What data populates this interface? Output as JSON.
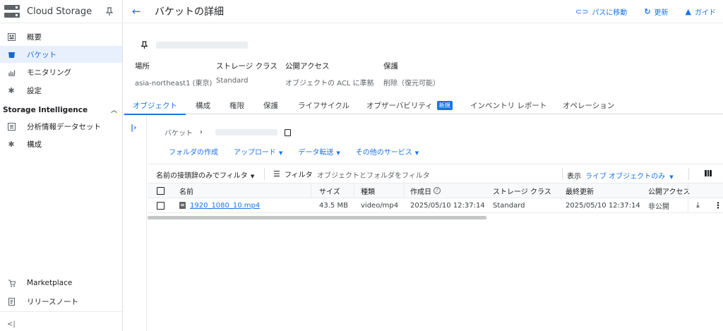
{
  "sidebar": {
    "product_title": "Cloud Storage",
    "items": [
      {
        "label": "概要",
        "icon": "dashboard-icon"
      },
      {
        "label": "バケット",
        "icon": "bucket-icon",
        "active": true
      },
      {
        "label": "モニタリング",
        "icon": "monitoring-icon"
      },
      {
        "label": "設定",
        "icon": "gear-icon"
      }
    ],
    "section_title": "Storage Intelligence",
    "section_items": [
      {
        "label": "分析情報データセット",
        "icon": "dataset-icon"
      },
      {
        "label": "構成",
        "icon": "gear-icon"
      }
    ],
    "bottom_items": [
      {
        "label": "Marketplace",
        "icon": "marketplace-icon"
      },
      {
        "label": "リリースノート",
        "icon": "release-notes-icon"
      }
    ],
    "collapse_glyph": "<|"
  },
  "header": {
    "title": "バケットの詳細",
    "actions": [
      {
        "label": "パスに移動",
        "icon": "link-icon"
      },
      {
        "label": "更新",
        "icon": "refresh-icon"
      },
      {
        "label": "ガイド",
        "icon": "school-icon"
      }
    ]
  },
  "bucket": {
    "meta": [
      {
        "key": "場所",
        "value": "asia-northeast1 (東京)"
      },
      {
        "key": "ストレージ クラス",
        "value": "Standard"
      },
      {
        "key": "公開アクセス",
        "value": "オブジェクトの ACL に準拠"
      },
      {
        "key": "保護",
        "value": "削除（復元可能）"
      }
    ]
  },
  "tabs": [
    {
      "label": "オブジェクト",
      "active": true
    },
    {
      "label": "構成"
    },
    {
      "label": "権限"
    },
    {
      "label": "保護"
    },
    {
      "label": "ライフサイクル"
    },
    {
      "label": "オブザーバビリティ",
      "badge": "新規"
    },
    {
      "label": "インベントリ レポート"
    },
    {
      "label": "オペレーション"
    }
  ],
  "breadcrumb": {
    "root": "バケット"
  },
  "actions": [
    {
      "label": "フォルダの作成",
      "dropdown": false
    },
    {
      "label": "アップロード",
      "dropdown": true
    },
    {
      "label": "データ転送",
      "dropdown": true
    },
    {
      "label": "その他のサービス",
      "dropdown": true
    }
  ],
  "filterbar": {
    "prefix_label": "名前の接頭辞のみでフィルタ",
    "filter_label": "フィルタ",
    "placeholder": "オブジェクトとフォルダをフィルタ",
    "show_label": "表示",
    "show_value": "ライブ オブジェクトのみ"
  },
  "table": {
    "columns": [
      "名前",
      "サイズ",
      "種類",
      "作成日",
      "ストレージ クラス",
      "最終更新",
      "公開アクセス"
    ],
    "rows": [
      {
        "name": "1920_1080_10.mp4",
        "size": "43.5 MB",
        "type": "video/mp4",
        "created": "2025/05/10 12:37:14",
        "storage_class": "Standard",
        "updated": "2025/05/10 12:37:14",
        "public_access": "非公開"
      }
    ]
  },
  "colors": {
    "accent": "#1a73e8",
    "active_bg": "#e8f0fe",
    "border": "#dadce0"
  }
}
